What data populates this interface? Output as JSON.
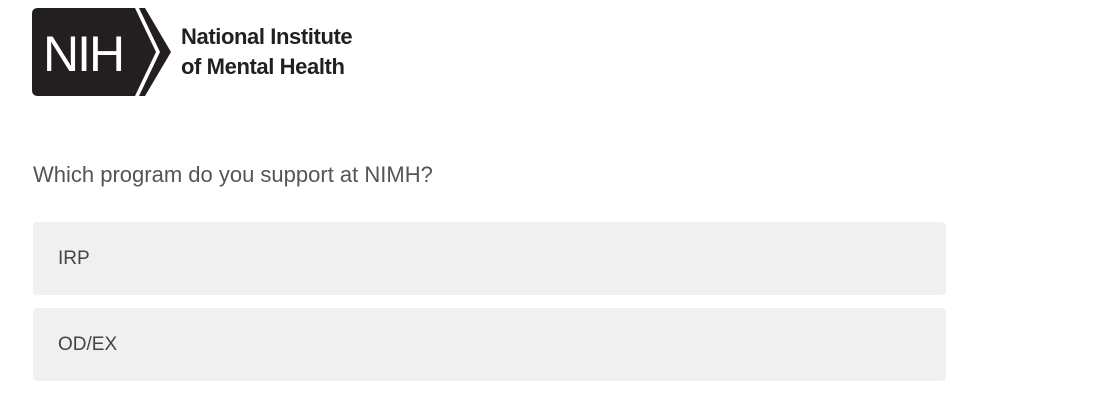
{
  "logo": {
    "abbrev": "NIH",
    "line1": "National Institute",
    "line2": "of Mental Health",
    "mark_color": "#231f20"
  },
  "question": "Which program do you support at NIMH?",
  "options": [
    {
      "label": "IRP"
    },
    {
      "label": "OD/EX"
    }
  ],
  "colors": {
    "option_background": "#f0f0f0",
    "question_text": "#555555",
    "option_text": "#444444"
  }
}
